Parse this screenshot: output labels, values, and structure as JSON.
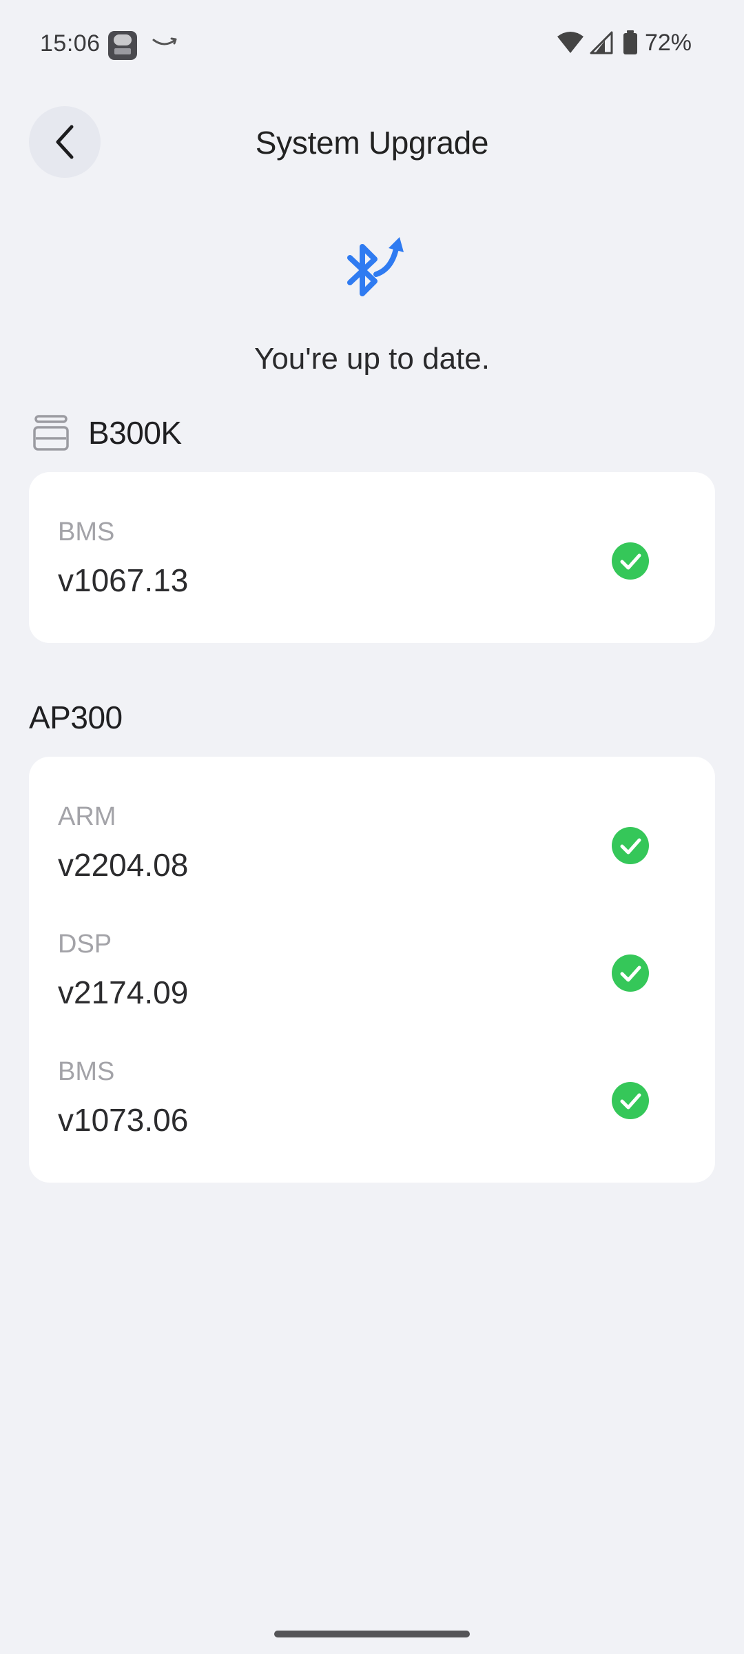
{
  "status_bar": {
    "time": "15:06",
    "battery_percent": "72%"
  },
  "header": {
    "title": "System Upgrade"
  },
  "status": {
    "message": "You're up to date."
  },
  "devices": [
    {
      "name": "B300K",
      "firmware": [
        {
          "label": "BMS",
          "version": "v1067.13",
          "up_to_date": true
        }
      ]
    },
    {
      "name": "AP300",
      "firmware": [
        {
          "label": "ARM",
          "version": "v2204.08",
          "up_to_date": true
        },
        {
          "label": "DSP",
          "version": "v2174.09",
          "up_to_date": true
        },
        {
          "label": "BMS",
          "version": "v1073.06",
          "up_to_date": true
        }
      ]
    }
  ],
  "colors": {
    "background": "#f1f2f6",
    "card": "#ffffff",
    "accent_blue": "#2f7bf1",
    "success_green": "#35c759",
    "label_gray": "#a3a3a8"
  },
  "icons": {
    "back": "chevron-left-icon",
    "upgrade": "bluetooth-upgrade-icon",
    "battery_pack": "battery-stack-icon",
    "check": "check-circle-icon"
  }
}
